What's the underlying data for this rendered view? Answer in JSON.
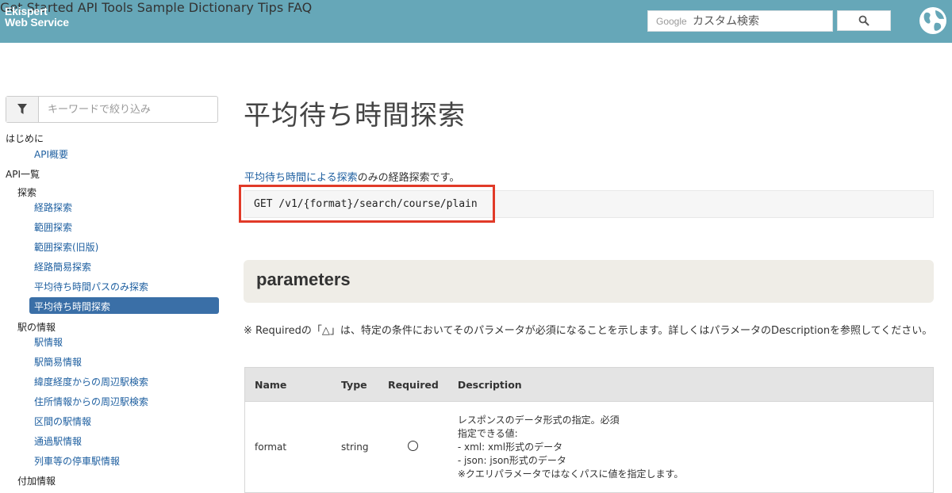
{
  "header": {
    "logo_line1": "Ekispert",
    "logo_line2": "Web Service",
    "nav": [
      "Get Started",
      "API",
      "Tools",
      "Sample",
      "Dictionary",
      "Tips",
      "FAQ"
    ],
    "search_brand": "Google",
    "search_placeholder": "カスタム検索",
    "colors": {
      "bar": "#66a7b8",
      "nav_text": "#1d3944"
    },
    "icons": {
      "search": "search-icon",
      "globe": "globe-icon"
    }
  },
  "sidebar": {
    "filter_placeholder": "キーワードで絞り込み",
    "items": [
      {
        "label": "はじめに",
        "level": 0
      },
      {
        "label": "API概要",
        "level": 2
      },
      {
        "label": "API一覧",
        "level": 0
      },
      {
        "label": "探索",
        "level": 1
      },
      {
        "label": "経路探索",
        "level": 2
      },
      {
        "label": "範囲探索",
        "level": 2
      },
      {
        "label": "範囲探索(旧版)",
        "level": 2
      },
      {
        "label": "経路簡易探索",
        "level": 2
      },
      {
        "label": "平均待ち時間パスのみ探索",
        "level": 2
      },
      {
        "label": "平均待ち時間探索",
        "level": 2,
        "active": true
      },
      {
        "label": "駅の情報",
        "level": 1
      },
      {
        "label": "駅情報",
        "level": 2
      },
      {
        "label": "駅簡易情報",
        "level": 2
      },
      {
        "label": "緯度経度からの周辺駅検索",
        "level": 2
      },
      {
        "label": "住所情報からの周辺駅検索",
        "level": 2
      },
      {
        "label": "区間の駅情報",
        "level": 2
      },
      {
        "label": "通過駅情報",
        "level": 2
      },
      {
        "label": "列車等の停車駅情報",
        "level": 2
      },
      {
        "label": "付加情報",
        "level": 1
      }
    ]
  },
  "main": {
    "title": "平均待ち時間探索",
    "lead_link": "平均待ち時間による探索",
    "lead_rest": "のみの経路探索です。",
    "endpoint": "GET /v1/{format}/search/course/plain",
    "section_title": "parameters",
    "note": "※ Requiredの「△」は、特定の条件においてそのパラメータが必須になることを示します。詳しくはパラメータのDescriptionを参照してください。",
    "table": {
      "headers": [
        "Name",
        "Type",
        "Required",
        "Description"
      ],
      "rows": [
        {
          "name": "format",
          "type": "string",
          "required": "○",
          "description": [
            "レスポンスのデータ形式の指定。必須",
            "指定できる値:",
            "- xml: xml形式のデータ",
            "- json: json形式のデータ",
            "※クエリパラメータではなくパスに値を指定します。"
          ]
        }
      ]
    },
    "colors": {
      "highlight_border": "#e13a28",
      "link": "#1e5fa0",
      "active_item": "#3a6fa7"
    }
  }
}
